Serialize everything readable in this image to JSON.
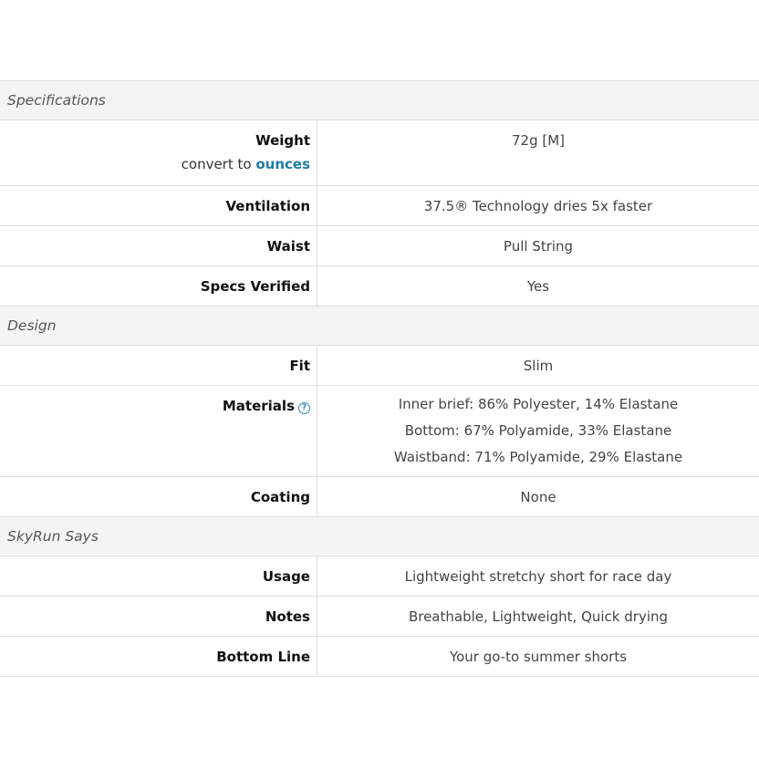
{
  "sections": [
    {
      "title": "Specifications",
      "rows": [
        {
          "label": "Weight",
          "convert_prefix": "convert to",
          "convert_link": "ounces",
          "values": [
            "72g [M]"
          ]
        },
        {
          "label": "Ventilation",
          "values": [
            "37.5® Technology dries 5x faster"
          ]
        },
        {
          "label": "Waist",
          "values": [
            "Pull String"
          ]
        },
        {
          "label": "Specs Verified",
          "values": [
            "Yes"
          ]
        }
      ]
    },
    {
      "title": "Design",
      "rows": [
        {
          "label": "Fit",
          "values": [
            "Slim"
          ]
        },
        {
          "label": "Materials",
          "help_icon": "?",
          "values": [
            "Inner brief: 86% Polyester, 14% Elastane",
            "Bottom: 67% Polyamide, 33% Elastane",
            "Waistband: 71% Polyamide, 29% Elastane"
          ]
        },
        {
          "label": "Coating",
          "values": [
            "None"
          ]
        }
      ]
    },
    {
      "title": "SkyRun Says",
      "rows": [
        {
          "label": "Usage",
          "values": [
            "Lightweight stretchy short for race day"
          ]
        },
        {
          "label": "Notes",
          "values": [
            "Breathable, Lightweight, Quick drying"
          ]
        },
        {
          "label": "Bottom Line",
          "values": [
            "Your go-to summer shorts"
          ]
        }
      ]
    }
  ],
  "colors": {
    "link": "#1f7aa8",
    "header_bg": "#f4f4f4",
    "border": "#dddddd"
  }
}
